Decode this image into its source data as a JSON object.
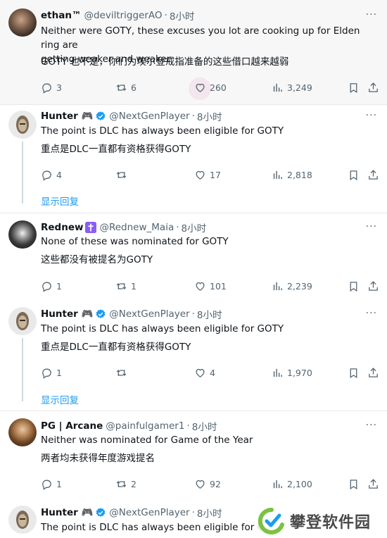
{
  "tweets": [
    {
      "name": "ethan™",
      "handle": "@deviltriggerAO",
      "time": "8小时",
      "text_lines": [
        "Neither were GOTY, these excuses you lot are cooking up for Elden ring are",
        "getting weaker and weaker"
      ],
      "translation": "GOTY 也不是，你们为埃尔登戒指准备的这些借口越来越弱",
      "replies": "3",
      "reposts": "6",
      "likes": "260",
      "views": "3,249"
    },
    {
      "name": "Hunter 🎮",
      "handle": "@NextGenPlayer",
      "time": "8小时",
      "text": "The point is DLC has always been eligible for GOTY",
      "translation": "重点是DLC一直都有资格获得GOTY",
      "replies": "4",
      "reposts": "",
      "likes": "17",
      "views": "2,818"
    },
    {
      "name": "Rednew",
      "handle": "@Rednew_Maia",
      "time": "8小时",
      "text": "None of these was nominated for GOTY",
      "translation": "这些都没有被提名为GOTY",
      "replies": "1",
      "reposts": "1",
      "likes": "101",
      "views": "2,239"
    },
    {
      "name": "Hunter 🎮",
      "handle": "@NextGenPlayer",
      "time": "8小时",
      "text": "The point is DLC has always been eligible for GOTY",
      "translation": "重点是DLC一直都有资格获得GOTY",
      "replies": "1",
      "reposts": "",
      "likes": "4",
      "views": "1,970"
    },
    {
      "name": "PG | Arcane",
      "handle": "@painfulgamer1",
      "time": "8小时",
      "text": "Neither was nominated for Game of the Year",
      "translation": "两者均未获得年度游戏提名",
      "replies": "1",
      "reposts": "2",
      "likes": "92",
      "views": "2,100"
    },
    {
      "name": "Hunter 🎮",
      "handle": "@NextGenPlayer",
      "time": "8小时",
      "text": "The point is DLC has always been eligible for G"
    }
  ],
  "show_replies_label": "显示回复",
  "dot": "·",
  "more_label": "···",
  "watermark": "攀登软件园",
  "colors": {
    "accent": "#1d9bf0",
    "verified": "#1d9bf0",
    "cross_badge": "#8b5cf6",
    "muted": "#536471"
  }
}
